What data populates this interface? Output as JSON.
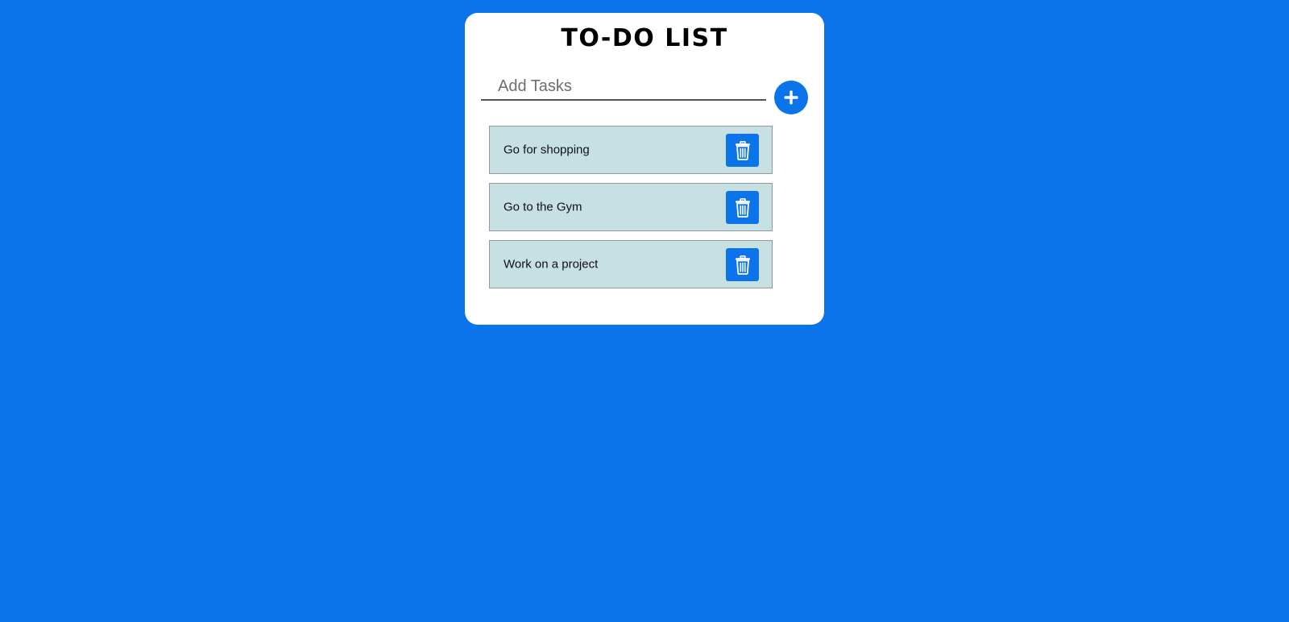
{
  "colors": {
    "background": "#0b74eb",
    "card": "#ffffff",
    "task_bg": "#c6e0e4",
    "accent": "#0b74eb"
  },
  "header": {
    "title": "TO-DO LIST"
  },
  "add_task": {
    "placeholder": "Add Tasks",
    "value": "",
    "button_icon": "plus-icon"
  },
  "tasks": [
    {
      "text": "Go for shopping",
      "delete_icon": "trash-icon"
    },
    {
      "text": "Go to the Gym",
      "delete_icon": "trash-icon"
    },
    {
      "text": "Work on a project",
      "delete_icon": "trash-icon"
    }
  ]
}
